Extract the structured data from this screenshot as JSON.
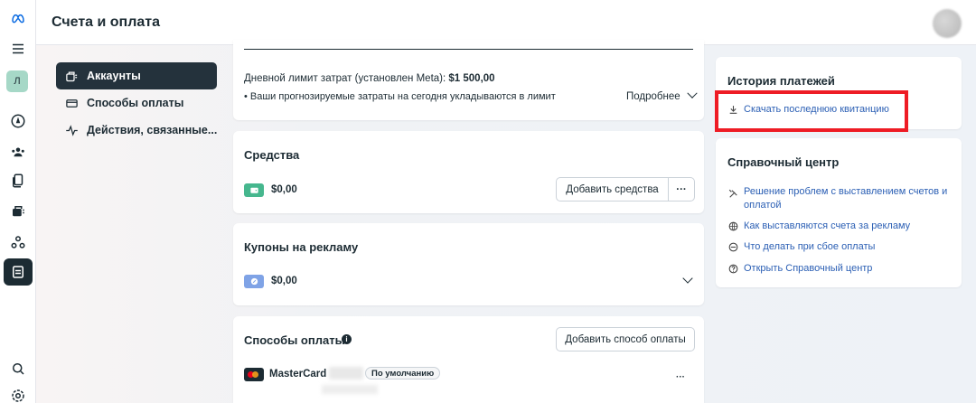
{
  "header": {
    "title": "Счета и оплата"
  },
  "rail": {
    "avatar_letter": "Л"
  },
  "subnav": {
    "items": [
      {
        "label": "Аккаунты",
        "active": true
      },
      {
        "label": "Способы оплаты",
        "active": false
      },
      {
        "label": "Действия, связанные...",
        "active": false
      }
    ]
  },
  "limit_card": {
    "daily_limit_label": "Дневной лимит затрат (установлен Meta): ",
    "daily_limit_value": "$1 500,00",
    "forecast_text": "• Ваши прогнозируемые затраты на сегодня укладываются в лимит",
    "details_label": "Подробнее"
  },
  "funds_card": {
    "title": "Средства",
    "amount": "$0,00",
    "add_button": "Добавить средства",
    "more_button": "···"
  },
  "coupons_card": {
    "title": "Купоны на рекламу",
    "amount": "$0,00"
  },
  "payment_methods_card": {
    "title": "Способы оплаты",
    "info_icon": "i",
    "add_button": "Добавить способ оплаты",
    "card_name": "MasterCard",
    "default_badge": "По умолчанию",
    "more_button": "···"
  },
  "payment_history": {
    "title": "История платежей",
    "download_link": "Скачать последнюю квитанцию"
  },
  "help_center": {
    "title": "Справочный центр",
    "links": [
      "Решение проблем с выставлением счетов и",
      "оплатой",
      "Как выставляются счета за рекламу",
      "Что делать при сбое оплаты",
      "Открыть Справочный центр"
    ]
  },
  "colors": {
    "accent_link": "#2b5fb4",
    "highlight_box": "#ee1c25",
    "funds_icon": "#46b78e",
    "coupon_icon": "#7fa3e6"
  }
}
